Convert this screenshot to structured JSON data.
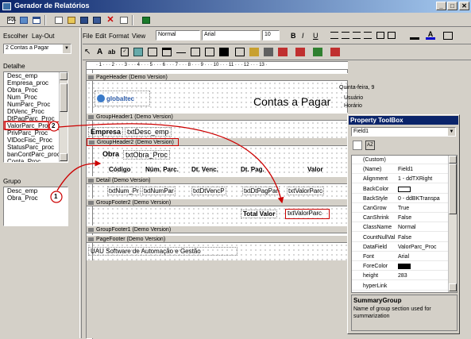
{
  "window": {
    "title": "Gerador de Relatórios",
    "min": "_",
    "max": "□",
    "close": "✕"
  },
  "menu": {
    "items": [
      "File",
      "Edit",
      "Format",
      "View"
    ]
  },
  "toolbar": {
    "style_value": "Normal",
    "font_value": "Arial",
    "size_value": "10",
    "bold": "B",
    "italic": "I",
    "underline": "U"
  },
  "left": {
    "escolher": "Escolher",
    "layout": "Lay-Out",
    "layout_select": "2 Contas a Pagar",
    "detalhe_label": "Detalhe",
    "detalhe_items": [
      "Desc_emp",
      "Empresa_proc",
      "Obra_Proc",
      "Num_Proc",
      "NumParc_Proc",
      "DtVenc_Proc",
      "DtPagParc_Proc",
      "ValorParc_Proc",
      "PrivParc_Proc",
      "VlDocFisc_Proc",
      "StatusParc_proc",
      "banContParc_proc",
      "Conta_Proc"
    ],
    "grupo_label": "Grupo",
    "grupo_items": [
      "Desc_emp",
      "Obra_Proc"
    ]
  },
  "designer": {
    "ruler": "· 1 · · · 2 · · · 3 · · · 4 · · · 5 · · · 6 · · · 7 · · · 8 · · · 9 · · · 10 · · · 11 · · · 12 · · · 13 ·",
    "bands": {
      "page_header": "PageHeader (Demo Version)",
      "group_header1": "GroupHeader1 (Demo Version)",
      "group_header2": "GroupHeader2 (Demo Version)",
      "detail": "Detail (Demo Version)",
      "group_footer2": "GroupFooter2 (Demo Version)",
      "group_footer1": "GroupFooter1 (Demo Version)",
      "page_footer": "PageFooter (Demo Version)"
    },
    "logo": "globaltec",
    "report_title": "Contas a Pagar",
    "right_header": {
      "date": "Quinta-feira, 9",
      "user": "Usuário",
      "time": "Horário"
    },
    "empresa_label": "Empresa",
    "empresa_field": "txtDesc_emp",
    "obra_label": "Obra",
    "obra_field": "txtObra_Proc",
    "columns": [
      "Código",
      "Núm. Parc.",
      "Dt. Venc.",
      "Dt. Pag.",
      "Valor"
    ],
    "detail_fields": [
      "txtNum_Pr",
      "txtNumPar",
      "txtDtVencP",
      "txtDtPagPar",
      "txtValorParc"
    ],
    "total_label": "Total Valor",
    "total_field": "txtValorParc",
    "footer_text": "UAU Software de Automação e Gestão"
  },
  "callouts": {
    "one": "1",
    "two": "2"
  },
  "ptb": {
    "title": "Property ToolBox",
    "object": "Field1",
    "props": [
      {
        "n": "(Custom)",
        "v": ""
      },
      {
        "n": "(Name)",
        "v": "Field1"
      },
      {
        "n": "Alignment",
        "v": "1 - ddTXRight"
      },
      {
        "n": "BackColor",
        "v": ""
      },
      {
        "n": "BackStyle",
        "v": "0 - ddBKTranspa"
      },
      {
        "n": "CanGrow",
        "v": "True"
      },
      {
        "n": "CanShrink",
        "v": "False"
      },
      {
        "n": "ClassName",
        "v": "Normal"
      },
      {
        "n": "CountNullVal",
        "v": "False"
      },
      {
        "n": "DataField",
        "v": "ValorParc_Proc"
      },
      {
        "n": "Font",
        "v": "Arial"
      },
      {
        "n": "ForeColor",
        "v": ""
      },
      {
        "n": "height",
        "v": "283"
      },
      {
        "n": "hyperLink",
        "v": ""
      }
    ],
    "desc_title": "SummaryGroup",
    "desc_text": "Name of group section used for summarization"
  },
  "colors": {
    "title_bar": "#0a246a",
    "callout": "#cc0000",
    "selection": "#0a246a"
  }
}
